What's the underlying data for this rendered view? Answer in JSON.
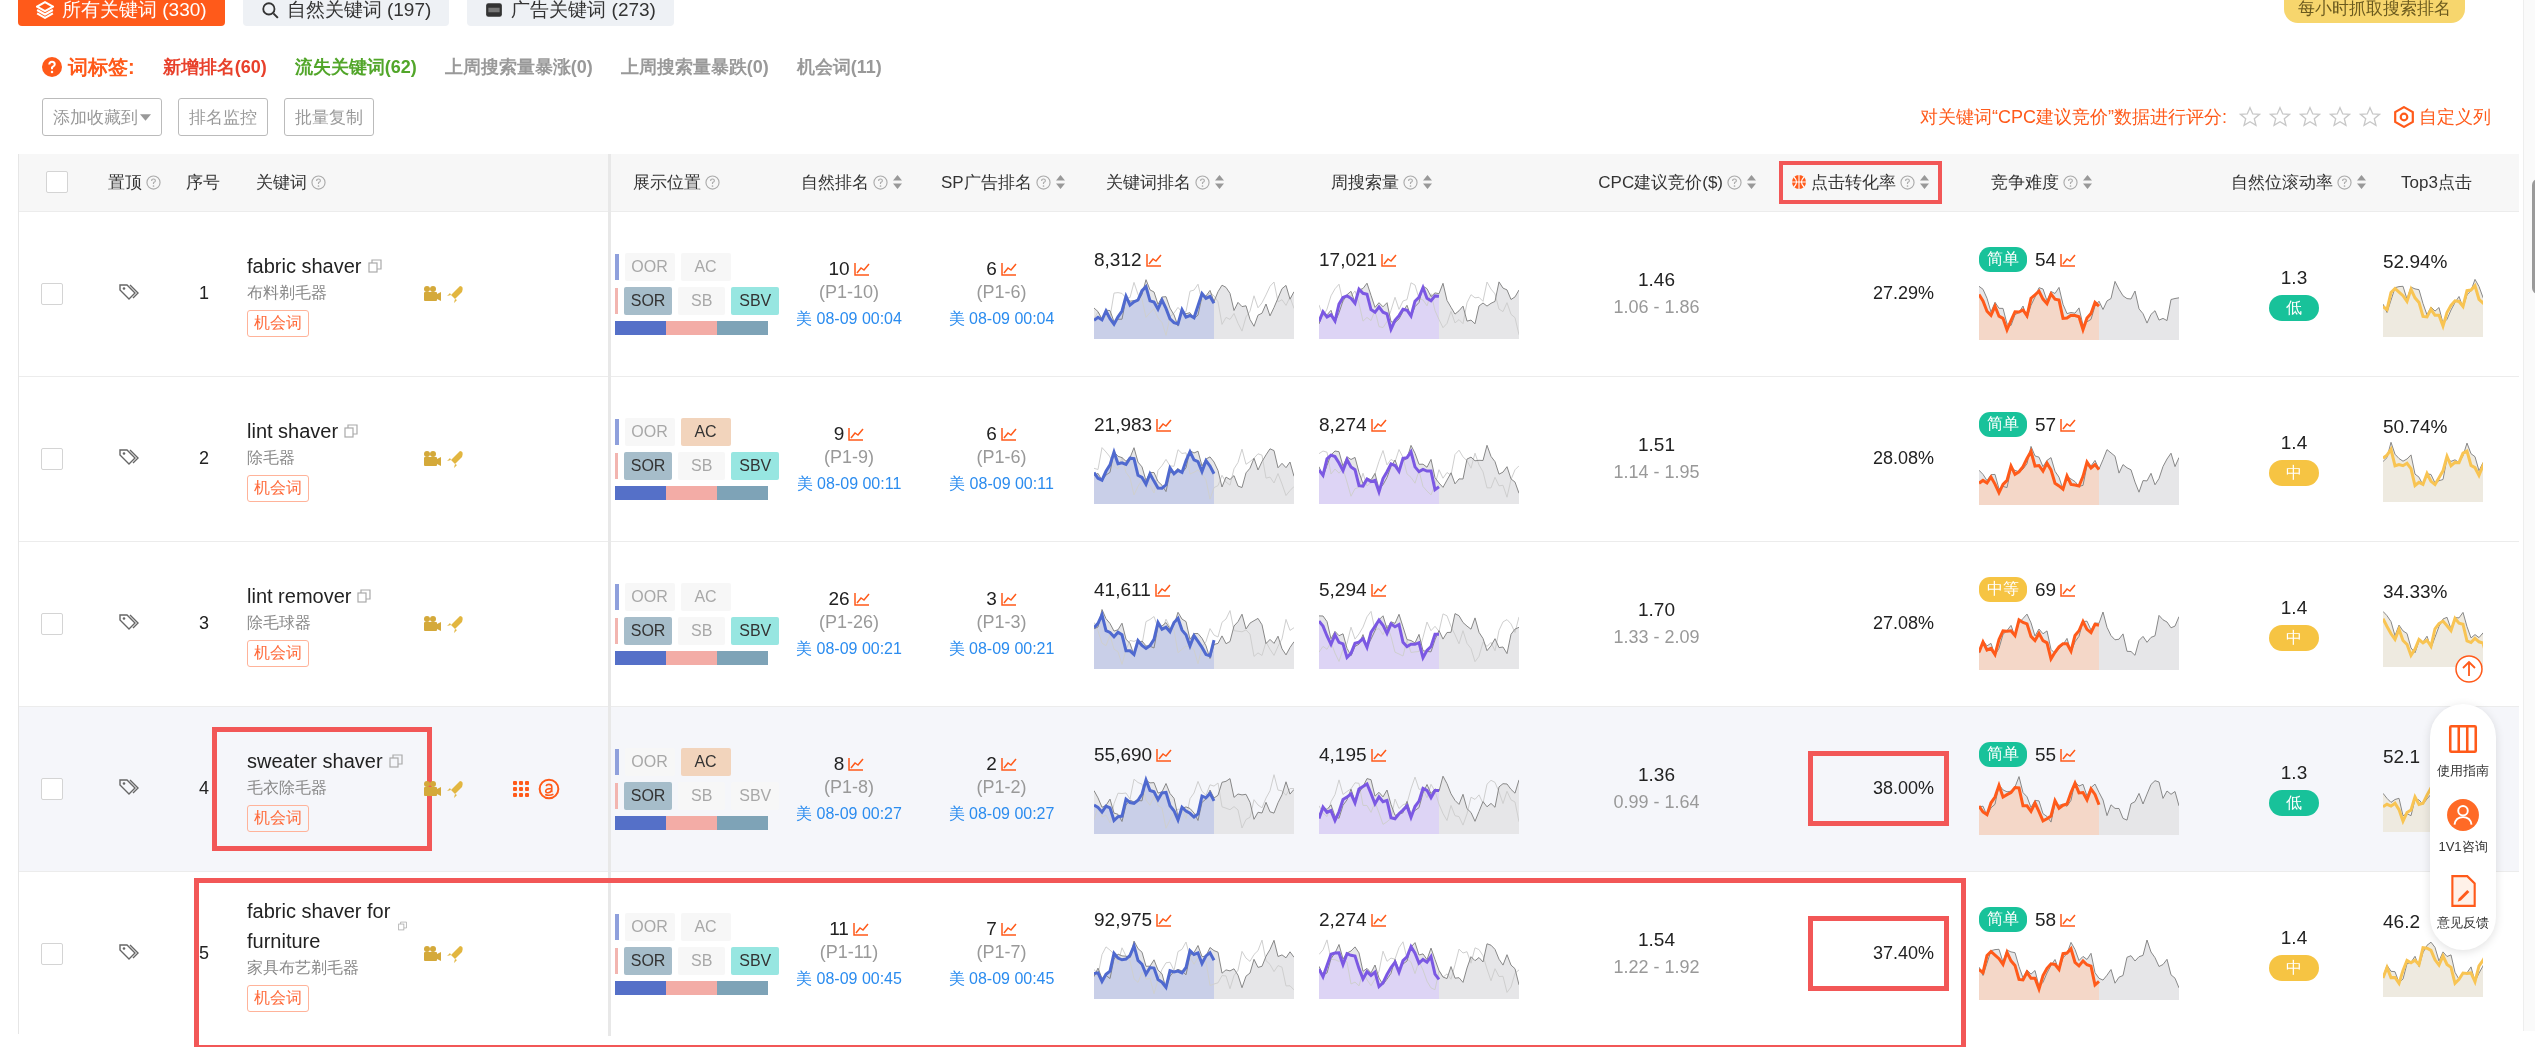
{
  "tabs": [
    {
      "label": "所有关键词 (330)",
      "selected": true,
      "kind": "all"
    },
    {
      "label": "自然关键词 (197)",
      "selected": false,
      "kind": "organic"
    },
    {
      "label": "广告关键词 (273)",
      "selected": false,
      "kind": "ad"
    }
  ],
  "hourly_badge": "每小时抓取搜索排名",
  "tag_bar": {
    "label": "词标签:",
    "tags": [
      {
        "label": "新增排名(60)",
        "color": "#e8402b"
      },
      {
        "label": "流失关键词(62)",
        "color": "#52a62a"
      },
      {
        "label": "上周搜索量暴涨(0)",
        "color": "#999999"
      },
      {
        "label": "上周搜索量暴跌(0)",
        "color": "#999999"
      },
      {
        "label": "机会词(11)",
        "color": "#999999"
      }
    ]
  },
  "actions": [
    {
      "label": "添加收藏到",
      "dropdown": true
    },
    {
      "label": "排名监控",
      "dropdown": false
    },
    {
      "label": "批量复制",
      "dropdown": false
    }
  ],
  "rating": {
    "label": "对关键词“CPC建议竞价”数据进行评分:",
    "stars": 0
  },
  "custom_columns": "自定义列",
  "table": {
    "select_all_checked": false,
    "columns": [
      {
        "label": "置顶",
        "help": true,
        "sortable": false,
        "highlighted": false
      },
      {
        "label": "序号",
        "help": false,
        "sortable": false,
        "highlighted": false
      },
      {
        "label": "关键词",
        "help": true,
        "sortable": false,
        "highlighted": false
      },
      {
        "label": "展示位置",
        "help": true,
        "sortable": false,
        "highlighted": false
      },
      {
        "label": "自然排名",
        "help": true,
        "sortable": true,
        "highlighted": false
      },
      {
        "label": "SP广告排名",
        "help": true,
        "sortable": true,
        "highlighted": false
      },
      {
        "label": "关键词排名",
        "help": true,
        "sortable": true,
        "highlighted": false
      },
      {
        "label": "周搜索量",
        "help": true,
        "sortable": true,
        "highlighted": false
      },
      {
        "label": "CPC建议竞价($)",
        "help": true,
        "sortable": true,
        "highlighted": false
      },
      {
        "label": "点击转化率",
        "help": true,
        "sortable": true,
        "highlighted": true
      },
      {
        "label": "竞争难度",
        "help": true,
        "sortable": true,
        "highlighted": false
      },
      {
        "label": "自然位滚动率",
        "help": true,
        "sortable": true,
        "highlighted": false
      },
      {
        "label": "Top3点击",
        "help": false,
        "sortable": false,
        "highlighted": false
      }
    ],
    "rows": [
      {
        "checked": false,
        "index": "1",
        "keyword": "fabric shaver",
        "translation": "布料剃毛器",
        "tag": "机会词",
        "hovered": false,
        "keyword_highlighted": false,
        "highlighted": false,
        "rate_highlighted": false,
        "placements": [
          {
            "label": "OOR",
            "on": false
          },
          {
            "label": "AC",
            "on": false
          },
          {
            "label": "SOR",
            "on": true
          },
          {
            "label": "SB",
            "on": false
          },
          {
            "label": "SBV",
            "on": true
          }
        ],
        "organic": {
          "rank": "10",
          "page": "(P1-10)",
          "time": "美 08-09 00:04"
        },
        "sp": {
          "rank": "6",
          "page": "(P1-6)",
          "time": "美 08-09 00:04"
        },
        "keyword_rank": "8,312",
        "weekly_search": "17,021",
        "cpc": "1.46",
        "cpc_range": "1.06 - 1.86",
        "conversion": "27.29%",
        "difficulty": {
          "label": "简单",
          "kind": "easy",
          "value": "54"
        },
        "rolling": {
          "value": "1.3",
          "label": "低",
          "kind": "low"
        },
        "top3": "52.94%"
      },
      {
        "checked": false,
        "index": "2",
        "keyword": "lint shaver",
        "translation": "除毛器",
        "tag": "机会词",
        "hovered": false,
        "keyword_highlighted": false,
        "highlighted": false,
        "rate_highlighted": false,
        "placements": [
          {
            "label": "OOR",
            "on": false
          },
          {
            "label": "AC",
            "on": true
          },
          {
            "label": "SOR",
            "on": true
          },
          {
            "label": "SB",
            "on": false
          },
          {
            "label": "SBV",
            "on": true
          }
        ],
        "organic": {
          "rank": "9",
          "page": "(P1-9)",
          "time": "美 08-09 00:11"
        },
        "sp": {
          "rank": "6",
          "page": "(P1-6)",
          "time": "美 08-09 00:11"
        },
        "keyword_rank": "21,983",
        "weekly_search": "8,274",
        "cpc": "1.51",
        "cpc_range": "1.14 - 1.95",
        "conversion": "28.08%",
        "difficulty": {
          "label": "简单",
          "kind": "easy",
          "value": "57"
        },
        "rolling": {
          "value": "1.4",
          "label": "中",
          "kind": "mid"
        },
        "top3": "50.74%"
      },
      {
        "checked": false,
        "index": "3",
        "keyword": "lint remover",
        "translation": "除毛球器",
        "tag": "机会词",
        "hovered": false,
        "keyword_highlighted": false,
        "highlighted": false,
        "rate_highlighted": false,
        "placements": [
          {
            "label": "OOR",
            "on": false
          },
          {
            "label": "AC",
            "on": false
          },
          {
            "label": "SOR",
            "on": true
          },
          {
            "label": "SB",
            "on": false
          },
          {
            "label": "SBV",
            "on": true
          }
        ],
        "organic": {
          "rank": "26",
          "page": "(P1-26)",
          "time": "美 08-09 00:21"
        },
        "sp": {
          "rank": "3",
          "page": "(P1-3)",
          "time": "美 08-09 00:21"
        },
        "keyword_rank": "41,611",
        "weekly_search": "5,294",
        "cpc": "1.70",
        "cpc_range": "1.33 - 2.09",
        "conversion": "27.08%",
        "difficulty": {
          "label": "中等",
          "kind": "medium",
          "value": "69"
        },
        "rolling": {
          "value": "1.4",
          "label": "中",
          "kind": "mid"
        },
        "top3": "34.33%"
      },
      {
        "checked": false,
        "index": "4",
        "keyword": "sweater shaver",
        "translation": "毛衣除毛器",
        "tag": "机会词",
        "hovered": true,
        "keyword_highlighted": true,
        "highlighted": false,
        "rate_highlighted": true,
        "placements": [
          {
            "label": "OOR",
            "on": false
          },
          {
            "label": "AC",
            "on": true
          },
          {
            "label": "SOR",
            "on": true
          },
          {
            "label": "SB",
            "on": false
          },
          {
            "label": "SBV",
            "on": false
          }
        ],
        "organic": {
          "rank": "8",
          "page": "(P1-8)",
          "time": "美 08-09 00:27"
        },
        "sp": {
          "rank": "2",
          "page": "(P1-2)",
          "time": "美 08-09 00:27"
        },
        "keyword_rank": "55,690",
        "weekly_search": "4,195",
        "cpc": "1.36",
        "cpc_range": "0.99 - 1.64",
        "conversion": "38.00%",
        "difficulty": {
          "label": "简单",
          "kind": "easy",
          "value": "55"
        },
        "rolling": {
          "value": "1.3",
          "label": "低",
          "kind": "low"
        },
        "top3": "52.1"
      },
      {
        "checked": false,
        "index": "5",
        "keyword": "fabric shaver for furniture",
        "translation": "家具布艺剃毛器",
        "tag": "机会词",
        "hovered": false,
        "keyword_highlighted": false,
        "highlighted": true,
        "rate_highlighted": true,
        "placements": [
          {
            "label": "OOR",
            "on": false
          },
          {
            "label": "AC",
            "on": false
          },
          {
            "label": "SOR",
            "on": true
          },
          {
            "label": "SB",
            "on": false
          },
          {
            "label": "SBV",
            "on": true
          }
        ],
        "organic": {
          "rank": "11",
          "page": "(P1-11)",
          "time": "美 08-09 00:45"
        },
        "sp": {
          "rank": "7",
          "page": "(P1-7)",
          "time": "美 08-09 00:45"
        },
        "keyword_rank": "92,975",
        "weekly_search": "2,274",
        "cpc": "1.54",
        "cpc_range": "1.22 - 1.92",
        "conversion": "37.40%",
        "difficulty": {
          "label": "简单",
          "kind": "easy",
          "value": "58"
        },
        "rolling": {
          "value": "1.4",
          "label": "中",
          "kind": "mid"
        },
        "top3": "46.2"
      }
    ]
  },
  "float_panel": [
    {
      "label": "使用指南",
      "kind": "guide"
    },
    {
      "label": "1V1咨询",
      "kind": "consult"
    },
    {
      "label": "意见反馈",
      "kind": "feedback"
    }
  ]
}
